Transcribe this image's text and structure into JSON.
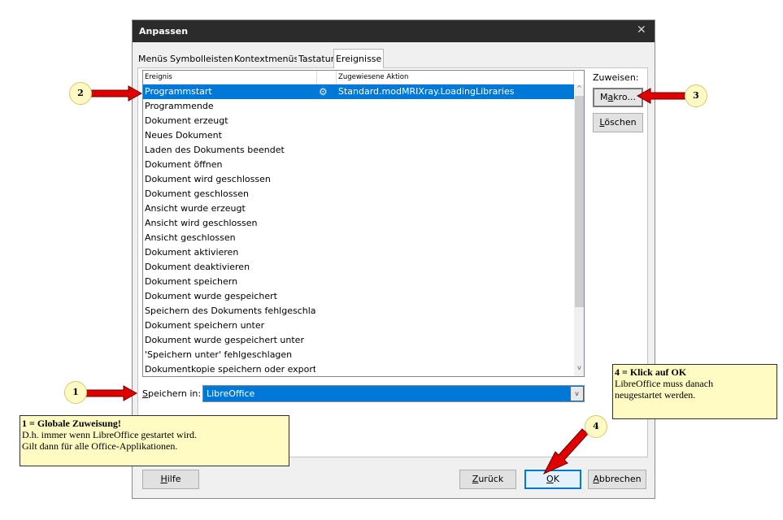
{
  "dialog": {
    "title": "Anpassen",
    "close_icon": "✕",
    "tabs": [
      "Menüs",
      "Symbolleisten",
      "Kontextmenüs",
      "Tastatur",
      "Ereignisse"
    ],
    "active_tab": "Ereignisse"
  },
  "events_table": {
    "col_event": "Ereignis",
    "col_action": "Zugewiesene Aktion",
    "rows": [
      {
        "event": "Programmstart",
        "action": "Standard.modMRIXray.LoadingLibraries",
        "selected": true
      },
      {
        "event": "Programmende"
      },
      {
        "event": "Dokument erzeugt"
      },
      {
        "event": "Neues Dokument"
      },
      {
        "event": "Laden des Dokuments beendet"
      },
      {
        "event": "Dokument öffnen"
      },
      {
        "event": "Dokument wird geschlossen"
      },
      {
        "event": "Dokument geschlossen"
      },
      {
        "event": "Ansicht wurde erzeugt"
      },
      {
        "event": "Ansicht wird geschlossen"
      },
      {
        "event": "Ansicht geschlossen"
      },
      {
        "event": "Dokument aktivieren"
      },
      {
        "event": "Dokument deaktivieren"
      },
      {
        "event": "Dokument speichern"
      },
      {
        "event": "Dokument wurde gespeichert"
      },
      {
        "event": "Speichern des Dokuments fehlgeschlage"
      },
      {
        "event": "Dokument speichern unter"
      },
      {
        "event": "Dokument wurde gespeichert unter"
      },
      {
        "event": "'Speichern unter' fehlgeschlagen"
      },
      {
        "event": "Dokumentkopie speichern oder exportie"
      }
    ],
    "scroll_up_icon": "^",
    "scroll_down_icon": "v",
    "gear_icon": "⚙"
  },
  "assign": {
    "label": "Zuweisen:",
    "macro_accel": "a",
    "macro_pre": "M",
    "macro_post": "kro...",
    "delete_accel": "L",
    "delete_rest": "öschen"
  },
  "save_in": {
    "label_accel": "S",
    "label_rest": "peichern in:",
    "value": "LibreOffice",
    "arrow_icon": "v"
  },
  "footer": {
    "help_accel": "H",
    "help_rest": "ilfe",
    "back_accel": "Z",
    "back_rest": "urück",
    "ok_accel": "O",
    "ok_rest": "K",
    "cancel_accel": "A",
    "cancel_rest": "bbrechen"
  },
  "annotations": {
    "badge1": "1",
    "badge2": "2",
    "badge3": "3",
    "badge4": "4",
    "note1_title": "1 = Globale Zuweisung!",
    "note1_line1": "D.h. immer wenn LibreOffice gestartet wird.",
    "note1_line2": "Gilt dann für alle Office-Applikationen.",
    "note4_title": "4 = Klick auf OK",
    "note4_line1": "LibreOffice muss danach",
    "note4_line2": "neugestartet werden.",
    "arrow_color": "#e00000"
  }
}
